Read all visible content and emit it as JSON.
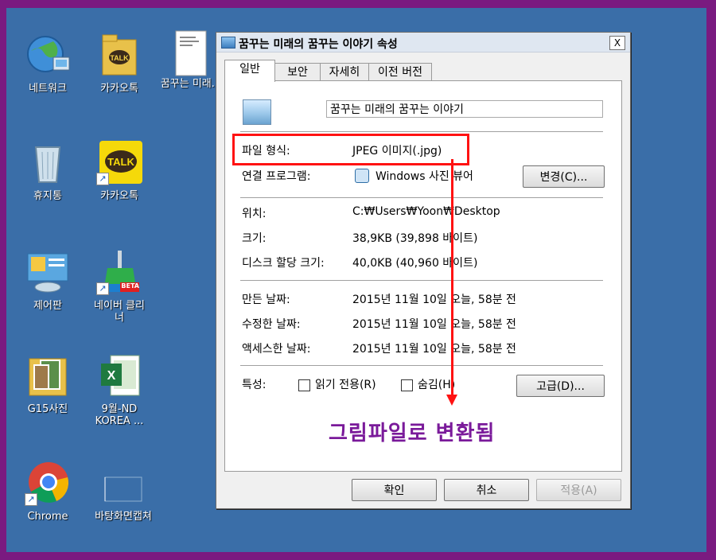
{
  "desktop": {
    "icons": [
      {
        "label": "네트워크",
        "icon": "network-icon"
      },
      {
        "label": "카카오톡",
        "icon": "kakaotalk-folder-icon"
      },
      {
        "label": "꿈꾸는 미래...",
        "icon": "document-icon"
      },
      {
        "label": "휴지통",
        "icon": "recycle-bin-icon"
      },
      {
        "label": "카카오톡",
        "icon": "kakaotalk-icon"
      },
      {
        "label": "제어판",
        "icon": "control-panel-icon"
      },
      {
        "label": "네이버 클리너",
        "icon": "naver-cleaner-icon",
        "badge": "BETA"
      },
      {
        "label": "G15사진",
        "icon": "photo-folder-icon"
      },
      {
        "label": "9월-ND KOREA ...",
        "icon": "excel-icon"
      },
      {
        "label": "Chrome",
        "icon": "chrome-icon"
      },
      {
        "label": "바탕화면캡쳐",
        "icon": "capture-icon"
      }
    ]
  },
  "dialog": {
    "title": "꿈꾸는 미래의 꿈꾸는 이야기 속성",
    "close_label": "X",
    "tabs": [
      "일반",
      "보안",
      "자세히",
      "이전 버전"
    ],
    "file_name": "꿈꾸는 미래의 꿈꾸는 이야기",
    "file_type_label": "파일 형식:",
    "file_type_value": "JPEG 이미지(.jpg)",
    "opens_with_label": "연결 프로그램:",
    "opens_with_value": "Windows 사진 뷰어",
    "change_button": "변경(C)...",
    "location_label": "위치:",
    "location_value": "C:₩Users₩Yoon₩Desktop",
    "size_label": "크기:",
    "size_value": "38,9KB (39,898 바이트)",
    "disk_size_label": "디스크 할당 크기:",
    "disk_size_value": "40,0KB (40,960 바이트)",
    "created_label": "만든 날짜:",
    "created_value": "2015년 11월 10일 오늘, 58분 전",
    "modified_label": "수정한 날짜:",
    "modified_value": "2015년 11월 10일 오늘, 58분 전",
    "accessed_label": "액세스한 날짜:",
    "accessed_value": "2015년 11월 10일 오늘, 58분 전",
    "attributes_label": "특성:",
    "readonly_label": "읽기 전용(R)",
    "hidden_label": "숨김(H)",
    "advanced_button": "고급(D)...",
    "ok_button": "확인",
    "cancel_button": "취소",
    "apply_button": "적용(A)"
  },
  "annotation": {
    "note": "그림파일로 변환됨",
    "color": "#ff1212",
    "note_color": "#7a1a9a"
  }
}
